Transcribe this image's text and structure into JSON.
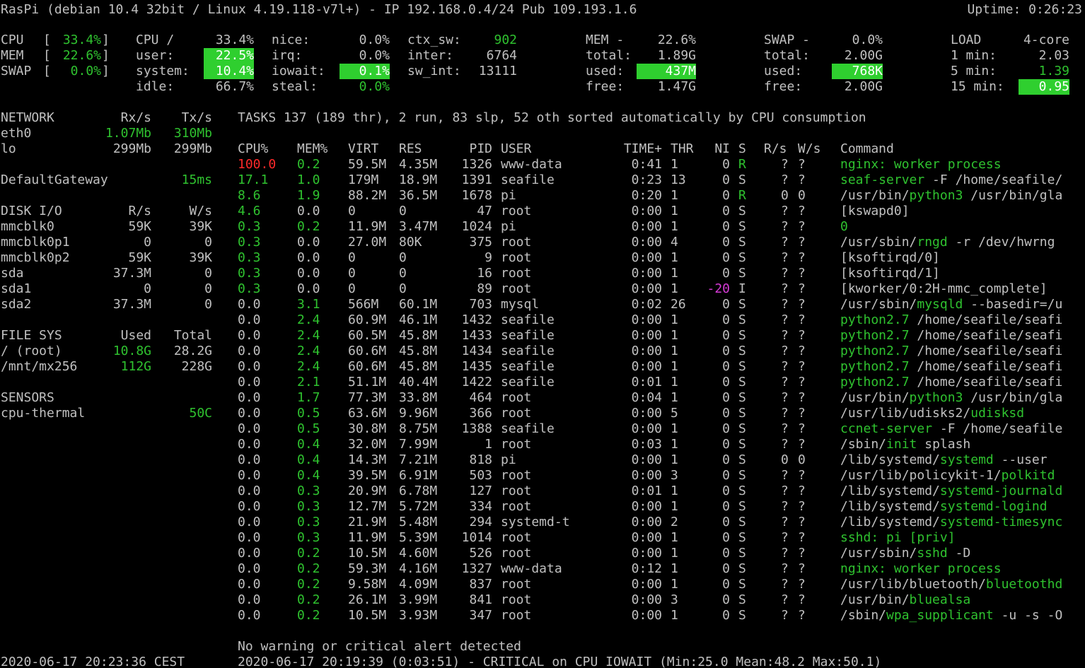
{
  "header": {
    "title": "RasPi (debian 10.4 32bit / Linux 4.19.118-v7l+) - IP 192.168.0.4/24 Pub 109.193.1.6",
    "uptime": "Uptime: 0:26:23"
  },
  "bars": [
    {
      "label": "CPU",
      "value": "33.4%"
    },
    {
      "label": "MEM",
      "value": "22.6%"
    },
    {
      "label": "SWAP",
      "value": "0.0%"
    }
  ],
  "cpu": {
    "title": "CPU /",
    "total": "33.4%",
    "user_label": "user:",
    "user": "22.5%",
    "system_label": "system:",
    "system": "10.4%",
    "idle_label": "idle:",
    "idle": "66.7%",
    "nice_label": "nice:",
    "nice": "0.0%",
    "irq_label": "irq:",
    "irq": "0.0%",
    "iowait_label": "iowait:",
    "iowait": "0.1%",
    "steal_label": "steal:",
    "steal": "0.0%",
    "ctx_sw_label": "ctx_sw:",
    "ctx_sw": "902",
    "inter_label": "inter:",
    "inter": "6764",
    "sw_int_label": "sw_int:",
    "sw_int": "13111"
  },
  "mem": {
    "title": "MEM -",
    "percent": "22.6%",
    "total_label": "total:",
    "total": "1.89G",
    "used_label": "used:",
    "used": "437M",
    "free_label": "free:",
    "free": "1.47G"
  },
  "swap": {
    "title": "SWAP -",
    "percent": "0.0%",
    "total_label": "total:",
    "total": "2.00G",
    "used_label": "used:",
    "used": "768K",
    "free_label": "free:",
    "free": "2.00G"
  },
  "load": {
    "title": "LOAD",
    "cores": "4-core",
    "rows": [
      {
        "label": "1 min:",
        "value": "2.03"
      },
      {
        "label": "5 min:",
        "value": "1.39"
      },
      {
        "label": "15 min:",
        "value": "0.95"
      }
    ]
  },
  "network": {
    "title": "NETWORK",
    "rx_header": "Rx/s",
    "tx_header": "Tx/s",
    "rows": [
      {
        "name": "eth0",
        "rx": "1.07Mb",
        "tx": "310Mb"
      },
      {
        "name": "lo",
        "rx": "299Mb",
        "tx": "299Mb"
      }
    ],
    "gateway_label": "DefaultGateway",
    "gateway_value": "15ms"
  },
  "disk": {
    "title": "DISK I/O",
    "r_header": "R/s",
    "w_header": "W/s",
    "rows": [
      {
        "name": "mmcblk0",
        "r": "59K",
        "w": "39K"
      },
      {
        "name": "mmcblk0p1",
        "r": "0",
        "w": "0"
      },
      {
        "name": "mmcblk0p2",
        "r": "59K",
        "w": "39K"
      },
      {
        "name": "sda",
        "r": "37.3M",
        "w": "0"
      },
      {
        "name": "sda1",
        "r": "0",
        "w": "0"
      },
      {
        "name": "sda2",
        "r": "37.3M",
        "w": "0"
      }
    ]
  },
  "filesys": {
    "title": "FILE SYS",
    "used_header": "Used",
    "total_header": "Total",
    "rows": [
      {
        "name": "/ (root)",
        "used": "10.8G",
        "total": "28.2G"
      },
      {
        "name": "/mnt/mx256",
        "used": "112G",
        "total": "228G"
      }
    ]
  },
  "sensors": {
    "title": "SENSORS",
    "rows": [
      {
        "name": "cpu-thermal",
        "value": "50C"
      }
    ]
  },
  "tasks": {
    "summary_prefix": "TASKS",
    "summary": "137 (189 thr), 2 run, 83 slp, 52 oth sorted automatically by CPU consumption",
    "columns": {
      "cpu": "CPU%",
      "mem": "MEM%",
      "virt": "VIRT",
      "res": "RES",
      "pid": "PID",
      "user": "USER",
      "time": "TIME+",
      "thr": "THR",
      "ni": "NI",
      "s": "S",
      "rs": "R/s",
      "ws": "W/s",
      "cmd": "Command"
    },
    "rows": [
      {
        "cpu": "100.0",
        "mem": "0.2",
        "virt": "59.5M",
        "res": "4.35M",
        "pid": "1326",
        "user": "www-data",
        "time": "0:41",
        "thr": "1",
        "ni": "0",
        "s": "R",
        "rs": "?",
        "ws": "?",
        "cmd_pre": "",
        "cmd_hl": "nginx: worker process",
        "cmd_post": ""
      },
      {
        "cpu": "17.1",
        "mem": "1.0",
        "virt": "179M",
        "res": "18.9M",
        "pid": "1391",
        "user": "seafile",
        "time": "0:23",
        "thr": "13",
        "ni": "0",
        "s": "S",
        "rs": "?",
        "ws": "?",
        "cmd_pre": "",
        "cmd_hl": "seaf-server",
        "cmd_post": " -F /home/seafile/"
      },
      {
        "cpu": "8.6",
        "mem": "1.9",
        "virt": "88.2M",
        "res": "36.5M",
        "pid": "1678",
        "user": "pi",
        "time": "0:20",
        "thr": "1",
        "ni": "0",
        "s": "R",
        "rs": "0",
        "ws": "0",
        "cmd_pre": "/usr/bin/",
        "cmd_hl": "python3",
        "cmd_post": " /usr/bin/gla"
      },
      {
        "cpu": "4.6",
        "mem": "0.0",
        "virt": "0",
        "res": "0",
        "pid": "47",
        "user": "root",
        "time": "0:00",
        "thr": "1",
        "ni": "0",
        "s": "S",
        "rs": "?",
        "ws": "?",
        "cmd_pre": "[kswapd0]",
        "cmd_hl": "",
        "cmd_post": ""
      },
      {
        "cpu": "0.3",
        "mem": "0.2",
        "virt": "11.9M",
        "res": "3.47M",
        "pid": "1024",
        "user": "pi",
        "time": "0:00",
        "thr": "1",
        "ni": "0",
        "s": "S",
        "rs": "?",
        "ws": "?",
        "cmd_pre": "",
        "cmd_hl": "0",
        "cmd_post": ""
      },
      {
        "cpu": "0.3",
        "mem": "0.0",
        "virt": "27.0M",
        "res": "80K",
        "pid": "375",
        "user": "root",
        "time": "0:00",
        "thr": "4",
        "ni": "0",
        "s": "S",
        "rs": "?",
        "ws": "?",
        "cmd_pre": "/usr/sbin/",
        "cmd_hl": "rngd",
        "cmd_post": " -r /dev/hwrng"
      },
      {
        "cpu": "0.3",
        "mem": "0.0",
        "virt": "0",
        "res": "0",
        "pid": "9",
        "user": "root",
        "time": "0:00",
        "thr": "1",
        "ni": "0",
        "s": "S",
        "rs": "?",
        "ws": "?",
        "cmd_pre": "[ksoftirqd/0]",
        "cmd_hl": "",
        "cmd_post": ""
      },
      {
        "cpu": "0.3",
        "mem": "0.0",
        "virt": "0",
        "res": "0",
        "pid": "16",
        "user": "root",
        "time": "0:00",
        "thr": "1",
        "ni": "0",
        "s": "S",
        "rs": "?",
        "ws": "?",
        "cmd_pre": "[ksoftirqd/1]",
        "cmd_hl": "",
        "cmd_post": ""
      },
      {
        "cpu": "0.3",
        "mem": "0.0",
        "virt": "0",
        "res": "0",
        "pid": "89",
        "user": "root",
        "time": "0:00",
        "thr": "1",
        "ni": "-20",
        "s": "I",
        "rs": "?",
        "ws": "?",
        "cmd_pre": "[kworker/0:2H-mmc_complete]",
        "cmd_hl": "",
        "cmd_post": ""
      },
      {
        "cpu": "0.0",
        "mem": "3.1",
        "virt": "566M",
        "res": "60.1M",
        "pid": "703",
        "user": "mysql",
        "time": "0:02",
        "thr": "26",
        "ni": "0",
        "s": "S",
        "rs": "?",
        "ws": "?",
        "cmd_pre": "/usr/sbin/",
        "cmd_hl": "mysqld",
        "cmd_post": " --basedir=/u"
      },
      {
        "cpu": "0.0",
        "mem": "2.4",
        "virt": "60.9M",
        "res": "46.1M",
        "pid": "1432",
        "user": "seafile",
        "time": "0:00",
        "thr": "1",
        "ni": "0",
        "s": "S",
        "rs": "?",
        "ws": "?",
        "cmd_pre": "",
        "cmd_hl": "python2.7",
        "cmd_post": " /home/seafile/seafi"
      },
      {
        "cpu": "0.0",
        "mem": "2.4",
        "virt": "60.5M",
        "res": "45.8M",
        "pid": "1433",
        "user": "seafile",
        "time": "0:00",
        "thr": "1",
        "ni": "0",
        "s": "S",
        "rs": "?",
        "ws": "?",
        "cmd_pre": "",
        "cmd_hl": "python2.7",
        "cmd_post": " /home/seafile/seafi"
      },
      {
        "cpu": "0.0",
        "mem": "2.4",
        "virt": "60.6M",
        "res": "45.8M",
        "pid": "1434",
        "user": "seafile",
        "time": "0:00",
        "thr": "1",
        "ni": "0",
        "s": "S",
        "rs": "?",
        "ws": "?",
        "cmd_pre": "",
        "cmd_hl": "python2.7",
        "cmd_post": " /home/seafile/seafi"
      },
      {
        "cpu": "0.0",
        "mem": "2.4",
        "virt": "60.6M",
        "res": "45.8M",
        "pid": "1435",
        "user": "seafile",
        "time": "0:00",
        "thr": "1",
        "ni": "0",
        "s": "S",
        "rs": "?",
        "ws": "?",
        "cmd_pre": "",
        "cmd_hl": "python2.7",
        "cmd_post": " /home/seafile/seafi"
      },
      {
        "cpu": "0.0",
        "mem": "2.1",
        "virt": "51.1M",
        "res": "40.4M",
        "pid": "1422",
        "user": "seafile",
        "time": "0:01",
        "thr": "1",
        "ni": "0",
        "s": "S",
        "rs": "?",
        "ws": "?",
        "cmd_pre": "",
        "cmd_hl": "python2.7",
        "cmd_post": " /home/seafile/seafi"
      },
      {
        "cpu": "0.0",
        "mem": "1.7",
        "virt": "77.3M",
        "res": "33.8M",
        "pid": "464",
        "user": "root",
        "time": "0:04",
        "thr": "1",
        "ni": "0",
        "s": "S",
        "rs": "?",
        "ws": "?",
        "cmd_pre": "/usr/bin/",
        "cmd_hl": "python3",
        "cmd_post": " /usr/bin/gla"
      },
      {
        "cpu": "0.0",
        "mem": "0.5",
        "virt": "63.6M",
        "res": "9.96M",
        "pid": "366",
        "user": "root",
        "time": "0:00",
        "thr": "5",
        "ni": "0",
        "s": "S",
        "rs": "?",
        "ws": "?",
        "cmd_pre": "/usr/lib/udisks2/",
        "cmd_hl": "udisksd",
        "cmd_post": ""
      },
      {
        "cpu": "0.0",
        "mem": "0.5",
        "virt": "30.8M",
        "res": "8.75M",
        "pid": "1388",
        "user": "seafile",
        "time": "0:00",
        "thr": "1",
        "ni": "0",
        "s": "S",
        "rs": "?",
        "ws": "?",
        "cmd_pre": "",
        "cmd_hl": "ccnet-server",
        "cmd_post": " -F /home/seafile"
      },
      {
        "cpu": "0.0",
        "mem": "0.4",
        "virt": "32.0M",
        "res": "7.99M",
        "pid": "1",
        "user": "root",
        "time": "0:03",
        "thr": "1",
        "ni": "0",
        "s": "S",
        "rs": "?",
        "ws": "?",
        "cmd_pre": "/sbin/",
        "cmd_hl": "init",
        "cmd_post": " splash"
      },
      {
        "cpu": "0.0",
        "mem": "0.4",
        "virt": "14.3M",
        "res": "7.21M",
        "pid": "818",
        "user": "pi",
        "time": "0:00",
        "thr": "1",
        "ni": "0",
        "s": "S",
        "rs": "0",
        "ws": "0",
        "cmd_pre": "/lib/systemd/",
        "cmd_hl": "systemd",
        "cmd_post": " --user"
      },
      {
        "cpu": "0.0",
        "mem": "0.4",
        "virt": "39.5M",
        "res": "6.91M",
        "pid": "503",
        "user": "root",
        "time": "0:00",
        "thr": "3",
        "ni": "0",
        "s": "S",
        "rs": "?",
        "ws": "?",
        "cmd_pre": "/usr/lib/policykit-1/",
        "cmd_hl": "polkitd",
        "cmd_post": ""
      },
      {
        "cpu": "0.0",
        "mem": "0.3",
        "virt": "20.9M",
        "res": "6.78M",
        "pid": "127",
        "user": "root",
        "time": "0:01",
        "thr": "1",
        "ni": "0",
        "s": "S",
        "rs": "?",
        "ws": "?",
        "cmd_pre": "/lib/systemd/",
        "cmd_hl": "systemd-journald",
        "cmd_post": ""
      },
      {
        "cpu": "0.0",
        "mem": "0.3",
        "virt": "12.7M",
        "res": "5.72M",
        "pid": "334",
        "user": "root",
        "time": "0:00",
        "thr": "1",
        "ni": "0",
        "s": "S",
        "rs": "?",
        "ws": "?",
        "cmd_pre": "/lib/systemd/",
        "cmd_hl": "systemd-logind",
        "cmd_post": ""
      },
      {
        "cpu": "0.0",
        "mem": "0.3",
        "virt": "21.9M",
        "res": "5.48M",
        "pid": "294",
        "user": "systemd-t",
        "time": "0:00",
        "thr": "2",
        "ni": "0",
        "s": "S",
        "rs": "?",
        "ws": "?",
        "cmd_pre": "/lib/systemd/",
        "cmd_hl": "systemd-timesync",
        "cmd_post": ""
      },
      {
        "cpu": "0.0",
        "mem": "0.3",
        "virt": "11.9M",
        "res": "5.39M",
        "pid": "1014",
        "user": "root",
        "time": "0:00",
        "thr": "1",
        "ni": "0",
        "s": "S",
        "rs": "?",
        "ws": "?",
        "cmd_pre": "",
        "cmd_hl": "sshd: pi [priv]",
        "cmd_post": ""
      },
      {
        "cpu": "0.0",
        "mem": "0.2",
        "virt": "10.5M",
        "res": "4.60M",
        "pid": "526",
        "user": "root",
        "time": "0:00",
        "thr": "1",
        "ni": "0",
        "s": "S",
        "rs": "?",
        "ws": "?",
        "cmd_pre": "/usr/sbin/",
        "cmd_hl": "sshd",
        "cmd_post": " -D"
      },
      {
        "cpu": "0.0",
        "mem": "0.2",
        "virt": "59.3M",
        "res": "4.16M",
        "pid": "1327",
        "user": "www-data",
        "time": "0:12",
        "thr": "1",
        "ni": "0",
        "s": "S",
        "rs": "?",
        "ws": "?",
        "cmd_pre": "",
        "cmd_hl": "nginx: worker process",
        "cmd_post": ""
      },
      {
        "cpu": "0.0",
        "mem": "0.2",
        "virt": "9.58M",
        "res": "4.09M",
        "pid": "837",
        "user": "root",
        "time": "0:00",
        "thr": "1",
        "ni": "0",
        "s": "S",
        "rs": "?",
        "ws": "?",
        "cmd_pre": "/usr/lib/bluetooth/",
        "cmd_hl": "bluetoothd",
        "cmd_post": ""
      },
      {
        "cpu": "0.0",
        "mem": "0.2",
        "virt": "26.1M",
        "res": "3.99M",
        "pid": "841",
        "user": "root",
        "time": "0:00",
        "thr": "3",
        "ni": "0",
        "s": "S",
        "rs": "?",
        "ws": "?",
        "cmd_pre": "/usr/bin/",
        "cmd_hl": "bluealsa",
        "cmd_post": ""
      },
      {
        "cpu": "0.0",
        "mem": "0.2",
        "virt": "10.5M",
        "res": "3.93M",
        "pid": "347",
        "user": "root",
        "time": "0:00",
        "thr": "1",
        "ni": "0",
        "s": "S",
        "rs": "?",
        "ws": "?",
        "cmd_pre": "/sbin/",
        "cmd_hl": "wpa_supplicant",
        "cmd_post": " -u -s -O"
      }
    ]
  },
  "alerts": {
    "status": "No warning or critical alert detected",
    "entry": "2020-06-17 20:19:39 (0:03:51) - CRITICAL on CPU IOWAIT (Min:25.0 Mean:48.2 Max:50.1)"
  },
  "footer": {
    "timestamp": "2020-06-17 20:23:36 CEST"
  },
  "colors": {
    "background": "#000000",
    "text": "#c0c0c0",
    "ok_green": "#2fc22f",
    "highlight_bg": "#2fcf2f",
    "critical_red": "#ff2a2a",
    "nice_magenta": "#d63ad6"
  }
}
